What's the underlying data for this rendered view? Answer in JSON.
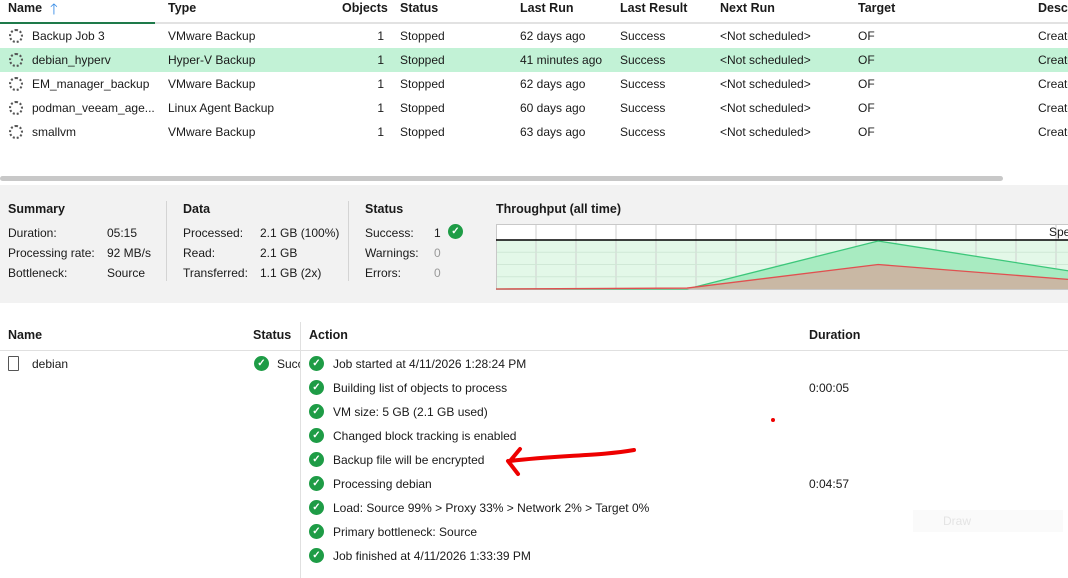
{
  "jobs": {
    "columns": [
      "Name",
      "Type",
      "Objects",
      "Status",
      "Last Run",
      "Last Result",
      "Next Run",
      "Target",
      "Descr"
    ],
    "rows": [
      {
        "name": "Backup Job 3",
        "type": "VMware Backup",
        "objects": "1",
        "status": "Stopped",
        "last_run": "62 days ago",
        "last_result": "Success",
        "next_run": "<Not scheduled>",
        "target": "OF",
        "descr": "Create"
      },
      {
        "name": "debian_hyperv",
        "type": "Hyper-V Backup",
        "objects": "1",
        "status": "Stopped",
        "last_run": "41 minutes ago",
        "last_result": "Success",
        "next_run": "<Not scheduled>",
        "target": "OF",
        "descr": "Create"
      },
      {
        "name": "EM_manager_backup",
        "type": "VMware Backup",
        "objects": "1",
        "status": "Stopped",
        "last_run": "62 days ago",
        "last_result": "Success",
        "next_run": "<Not scheduled>",
        "target": "OF",
        "descr": "Create"
      },
      {
        "name": "podman_veeam_age...",
        "type": "Linux Agent Backup",
        "objects": "1",
        "status": "Stopped",
        "last_run": "60 days ago",
        "last_result": "Success",
        "next_run": "<Not scheduled>",
        "target": "OF",
        "descr": "Create"
      },
      {
        "name": "smallvm",
        "type": "VMware Backup",
        "objects": "1",
        "status": "Stopped",
        "last_run": "63 days ago",
        "last_result": "Success",
        "next_run": "<Not scheduled>",
        "target": "OF",
        "descr": "Create"
      }
    ]
  },
  "summary": {
    "title": "Summary",
    "duration_label": "Duration:",
    "duration": "05:15",
    "rate_label": "Processing rate:",
    "rate": "92 MB/s",
    "bottleneck_label": "Bottleneck:",
    "bottleneck": "Source"
  },
  "data_section": {
    "title": "Data",
    "processed_label": "Processed:",
    "processed": "2.1 GB (100%)",
    "read_label": "Read:",
    "read": "2.1 GB",
    "transferred_label": "Transferred:",
    "transferred": "1.1 GB (2x)"
  },
  "status_section": {
    "title": "Status",
    "success_label": "Success:",
    "success": "1",
    "warnings_label": "Warnings:",
    "warnings": "0",
    "errors_label": "Errors:",
    "errors": "0"
  },
  "throughput": {
    "title": "Throughput (all time)",
    "speed_label": "Spe",
    "x": [
      0,
      0.334,
      0.668,
      1
    ],
    "processing": [
      0,
      0,
      100,
      38
    ],
    "read": [
      0,
      2,
      51,
      20
    ],
    "colors": {
      "processing": "#3cc77a",
      "read": "#e05050"
    }
  },
  "details": {
    "columns": {
      "name": "Name",
      "status": "Status",
      "action": "Action",
      "duration": "Duration"
    },
    "objects": [
      {
        "name": "debian",
        "status": "Succ"
      }
    ],
    "actions": [
      {
        "text": "Job started at 4/11/2026 1:28:24 PM",
        "duration": ""
      },
      {
        "text": "Building list of objects to process",
        "duration": "0:00:05"
      },
      {
        "text": "VM size: 5 GB (2.1 GB used)",
        "duration": ""
      },
      {
        "text": "Changed block tracking is enabled",
        "duration": ""
      },
      {
        "text": "Backup file will be encrypted",
        "duration": ""
      },
      {
        "text": "Processing debian",
        "duration": "0:04:57"
      },
      {
        "text": "Load: Source 99% > Proxy 33% > Network 2% > Target 0%",
        "duration": ""
      },
      {
        "text": "Primary bottleneck: Source",
        "duration": ""
      },
      {
        "text": "Job finished at 4/11/2026 1:33:39 PM",
        "duration": ""
      }
    ],
    "faint_button": "Draw"
  }
}
